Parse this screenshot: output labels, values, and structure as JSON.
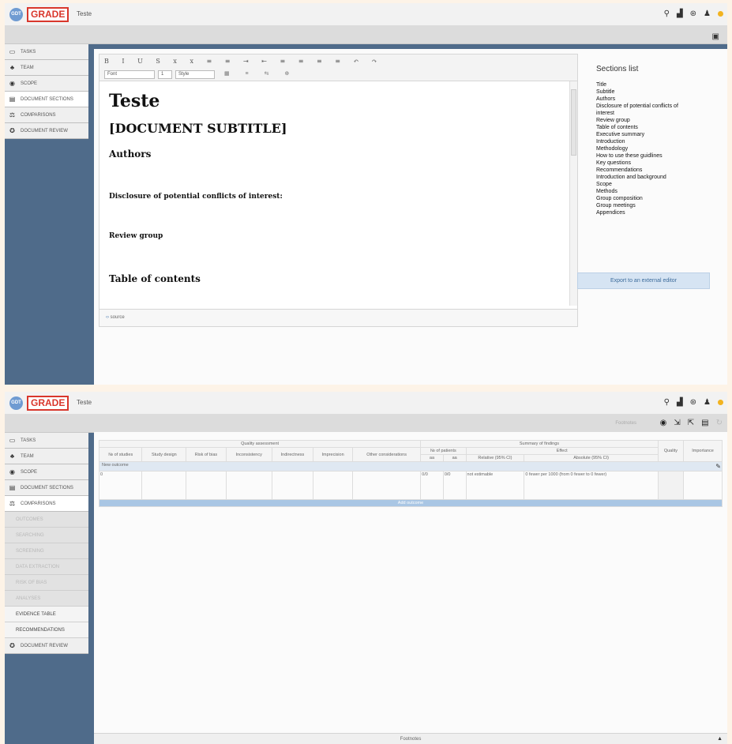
{
  "app": {
    "logo": "GDT",
    "brand": "GRADE",
    "project": "Teste"
  },
  "colors": {
    "accent": "#d9372c",
    "sidebar_bg": "#4f6b8a",
    "add_outcome_bg": "#a9c6e4"
  },
  "sidebar": {
    "items": [
      {
        "label": "TASKS",
        "icon": "calendar-icon"
      },
      {
        "label": "TEAM",
        "icon": "team-icon"
      },
      {
        "label": "SCOPE",
        "icon": "scope-icon"
      },
      {
        "label": "DOCUMENT SECTIONS",
        "icon": "document-icon"
      },
      {
        "label": "COMPARISONS",
        "icon": "scale-icon"
      },
      {
        "label": "DOCUMENT REVIEW",
        "icon": "review-icon"
      }
    ],
    "comparisons_sub": [
      "OUTCOMES",
      "SEARCHING",
      "SCREENING",
      "DATA EXTRACTION",
      "RISK OF BIAS",
      "ANALYSES",
      "EVIDENCE TABLE",
      "RECOMMENDATIONS"
    ]
  },
  "editor": {
    "toolbar": {
      "font": "Font",
      "size": "1",
      "style": "Style",
      "row1": "B I U S x x ≡ ≡ ⇥ ⇤ ≡ ≡ ≡ ≡ ↶ ↷",
      "row2": "▦ ≡ ⇆ ⊕"
    },
    "title": "Teste",
    "subtitle": "[DOCUMENT SUBTITLE]",
    "authors": "Authors",
    "disclosure": "Disclosure of potential conflicts of interest:",
    "review_group": "Review group",
    "toc": "Table of contents",
    "source": "source"
  },
  "sections": {
    "title": "Sections list",
    "items": [
      "Title",
      "Subtitle",
      "Authors",
      "Disclosure of potential conflicts of",
      "interest",
      "Review group",
      "Table of contents",
      "Executive summary",
      "Introduction",
      "Methodology",
      "How to use these guidlines",
      "Key questions",
      "Recommendations",
      "Introduction and background",
      "Scope",
      "Methods",
      "Group composition",
      "Group meetings",
      "Appendices"
    ],
    "export": "Export to an external editor"
  },
  "evidence": {
    "footnotes_label": "Footnotes",
    "hdr": {
      "qa": "Quality assessment",
      "sof": "Summary of findings",
      "patients": "№ of patients",
      "effect": "Effect",
      "quality": "Quality",
      "importance": "Importance"
    },
    "cols": [
      "№ of studies",
      "Study design",
      "Risk of bias",
      "Inconsistency",
      "Indirectness",
      "Imprecision",
      "Other considerations",
      "aa",
      "aa",
      "Relative (95% CI)",
      "Absolute (95% CI)"
    ],
    "new_outcome": "New outcome",
    "row": [
      "0",
      "",
      "",
      "",
      "",
      "",
      "",
      "0/0",
      "0/0",
      "not estimable",
      "0 fewer per 1000 (from 0 fewer to 0 fewer)"
    ],
    "add_outcome": "Add outcome",
    "footer": "Footnotes"
  }
}
